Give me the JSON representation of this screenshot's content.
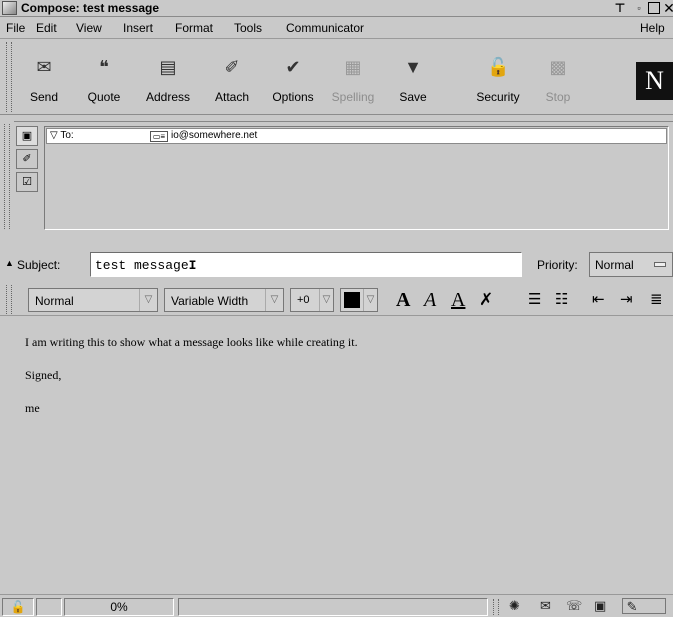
{
  "window": {
    "title": "Compose: test message"
  },
  "menus": [
    "File",
    "Edit",
    "View",
    "Insert",
    "Format",
    "Tools",
    "Communicator",
    "Help"
  ],
  "toolbar": {
    "buttons": [
      {
        "label": "Send",
        "icon": "send-icon",
        "enabled": true
      },
      {
        "label": "Quote",
        "icon": "quote-icon",
        "enabled": true
      },
      {
        "label": "Address",
        "icon": "address-book-icon",
        "enabled": true
      },
      {
        "label": "Attach",
        "icon": "paperclip-icon",
        "enabled": true
      },
      {
        "label": "Options",
        "icon": "options-icon",
        "enabled": true
      },
      {
        "label": "Spelling",
        "icon": "spelling-icon",
        "enabled": false
      },
      {
        "label": "Save",
        "icon": "save-icon",
        "enabled": true
      },
      {
        "label": "Security",
        "icon": "lock-icon",
        "enabled": true
      },
      {
        "label": "Stop",
        "icon": "stop-icon",
        "enabled": false
      }
    ],
    "logo": "N"
  },
  "address": {
    "field": "To:",
    "recipient": "io@somewhere.net"
  },
  "subject": {
    "label": "Subject:",
    "value": "test message"
  },
  "priority": {
    "label": "Priority:",
    "value": "Normal"
  },
  "format": {
    "paragraph_style": "Normal",
    "font": "Variable Width",
    "size": "+0",
    "text_color": "#000000"
  },
  "message": {
    "lines": [
      "I am writing this to show what a message looks like while creating it.",
      "Signed,",
      "me"
    ]
  },
  "status": {
    "progress_text": "0%"
  }
}
